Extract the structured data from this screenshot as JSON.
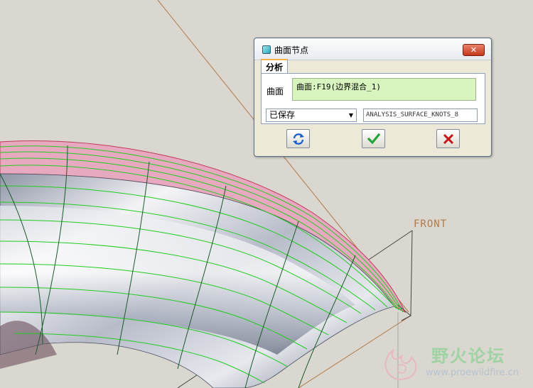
{
  "dialog": {
    "title": "曲面节点",
    "close_label": "✕",
    "tab_label": "分析",
    "surface_label": "曲面",
    "surface_value": "曲面:F19(边界混合_1)",
    "save_select_value": "已保存",
    "analysis_name": "ANALYSIS_SURFACE_KNOTS_8"
  },
  "viewport": {
    "datum_label": "FRONT"
  },
  "watermark": {
    "title": "野火论坛",
    "url": "www.proewildfire.cn"
  },
  "colors": {
    "background": "#d9d7cf",
    "surface_pink": "#e7a9c0",
    "mesh_green": "#22cc22",
    "ok_green": "#23a53a",
    "cancel_red": "#c01818",
    "datum_orange": "#b07a4a"
  }
}
